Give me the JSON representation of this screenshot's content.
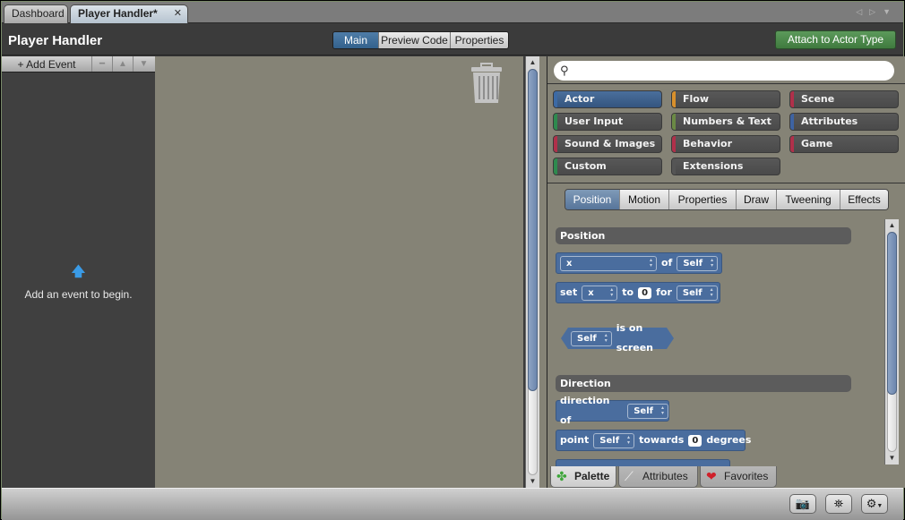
{
  "tabs": [
    {
      "label": "Dashboard",
      "active": false
    },
    {
      "label": "Player Handler*",
      "active": true,
      "close_icon": "close-icon"
    }
  ],
  "header": {
    "title": "Player Handler",
    "view_tabs": [
      {
        "label": "Main",
        "selected": true
      },
      {
        "label": "Preview Code",
        "selected": false
      },
      {
        "label": "Properties",
        "selected": false
      }
    ],
    "attach_button": "Attach to Actor Type"
  },
  "events": {
    "add_event_label": "+ Add Event",
    "remove_icon": "minus-icon",
    "up_icon": "up-arrow-icon",
    "down_icon": "down-arrow-icon",
    "empty_hint": "Add an event to begin.",
    "hint_icon": "up-arrow-icon"
  },
  "canvas": {
    "trash_icon": "trash-icon"
  },
  "palette": {
    "search": {
      "placeholder": "",
      "value": ""
    },
    "categories": [
      {
        "label": "Actor",
        "color": "#3c6aa5",
        "selected": true
      },
      {
        "label": "Flow",
        "color": "#d8902c"
      },
      {
        "label": "Scene",
        "color": "#b0304a"
      },
      {
        "label": "User Input",
        "color": "#2e8a4e"
      },
      {
        "label": "Numbers & Text",
        "color": "#6b8a45"
      },
      {
        "label": "Attributes",
        "color": "#3e63a2"
      },
      {
        "label": "Sound & Images",
        "color": "#b0304a"
      },
      {
        "label": "Behavior",
        "color": "#b0304a"
      },
      {
        "label": "Game",
        "color": "#b0304a"
      },
      {
        "label": "Custom",
        "color": "#2e8a4e"
      },
      {
        "label": "Extensions",
        "color": "#555555"
      }
    ],
    "subtabs": [
      {
        "label": "Position",
        "selected": true
      },
      {
        "label": "Motion"
      },
      {
        "label": "Properties"
      },
      {
        "label": "Draw"
      },
      {
        "label": "Tweening"
      },
      {
        "label": "Effects"
      }
    ],
    "sections": {
      "position": "Position",
      "direction": "Direction"
    },
    "blocks": {
      "get_of": {
        "dropdown": "x",
        "of": "of",
        "target": "Self"
      },
      "set_to": {
        "set": "set",
        "attr": "x",
        "to": "to",
        "value": "0",
        "for": "for",
        "target": "Self"
      },
      "on_screen": {
        "target": "Self",
        "text": "is on screen"
      },
      "direction_of": {
        "text": "direction of",
        "target": "Self"
      },
      "point_towards": {
        "point": "point",
        "target": "Self",
        "towards": "towards",
        "value": "0",
        "degrees": "degrees"
      }
    },
    "bottom_tabs": [
      {
        "label": "Palette",
        "icon": "puzzle-icon",
        "selected": true
      },
      {
        "label": "Attributes",
        "icon": "tag-icon"
      },
      {
        "label": "Favorites",
        "icon": "heart-icon"
      }
    ]
  },
  "statusbar": {
    "buttons": [
      {
        "icon": "camera-icon"
      },
      {
        "icon": "binoculars-icon"
      },
      {
        "icon": "gear-icon"
      }
    ]
  }
}
